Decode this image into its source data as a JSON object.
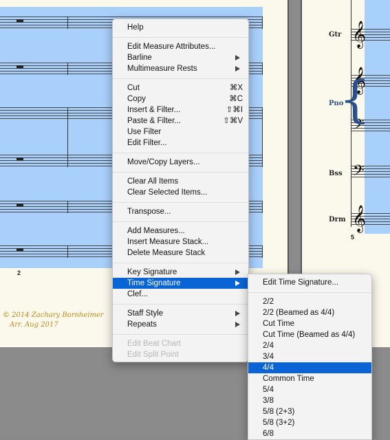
{
  "score": {
    "measure_numbers": [
      "2",
      "5"
    ],
    "copyright_line1": "© 2014 Zachary Bornheimer",
    "copyright_line2": "Arr. Aug 2017",
    "instruments": [
      "Gtr",
      "Pno",
      "Bss",
      "Drm"
    ]
  },
  "context_menu": {
    "items": [
      {
        "label": "Help"
      },
      {
        "label": "Edit Measure Attributes..."
      },
      {
        "label": "Barline",
        "submenu": true
      },
      {
        "label": "Multimeasure Rests",
        "submenu": true
      },
      {
        "label": "Cut",
        "shortcut": "⌘X"
      },
      {
        "label": "Copy",
        "shortcut": "⌘C"
      },
      {
        "label": "Insert & Filter...",
        "shortcut": "⇧⌘I"
      },
      {
        "label": "Paste & Filter...",
        "shortcut": "⇧⌘V"
      },
      {
        "label": "Use Filter"
      },
      {
        "label": "Edit Filter..."
      },
      {
        "label": "Move/Copy Layers..."
      },
      {
        "label": "Clear All Items"
      },
      {
        "label": "Clear Selected Items..."
      },
      {
        "label": "Transpose..."
      },
      {
        "label": "Add Measures..."
      },
      {
        "label": "Insert Measure Stack..."
      },
      {
        "label": "Delete Measure Stack"
      },
      {
        "label": "Key Signature",
        "submenu": true
      },
      {
        "label": "Time Signature",
        "submenu": true,
        "highlighted": true
      },
      {
        "label": "Clef..."
      },
      {
        "label": "Staff Style",
        "submenu": true
      },
      {
        "label": "Repeats",
        "submenu": true
      },
      {
        "label": "Edit Beat Chart",
        "disabled": true
      },
      {
        "label": "Edit Split Point",
        "disabled": true
      }
    ]
  },
  "time_signature_menu": {
    "items": [
      {
        "label": "Edit Time Signature..."
      },
      {
        "label": "2/2"
      },
      {
        "label": "2/2 (Beamed as 4/4)"
      },
      {
        "label": "Cut Time"
      },
      {
        "label": "Cut Time (Beamed as 4/4)"
      },
      {
        "label": "2/4"
      },
      {
        "label": "3/4"
      },
      {
        "label": "4/4",
        "highlighted": true
      },
      {
        "label": "Common Time"
      },
      {
        "label": "5/4"
      },
      {
        "label": "3/8"
      },
      {
        "label": "5/8 (2+3)"
      },
      {
        "label": "5/8 (3+2)"
      },
      {
        "label": "6/8"
      }
    ]
  },
  "colors": {
    "selection": "#a9cffb",
    "menu_highlight": "#0a64d6",
    "copyright": "#c08a1a",
    "piano_label": "#2a4f8a"
  },
  "icons": {
    "submenu_arrow": "triangle-right-icon",
    "treble_clef": "treble-clef-icon",
    "bass_clef": "bass-clef-icon",
    "whole_rest": "whole-rest-icon"
  }
}
